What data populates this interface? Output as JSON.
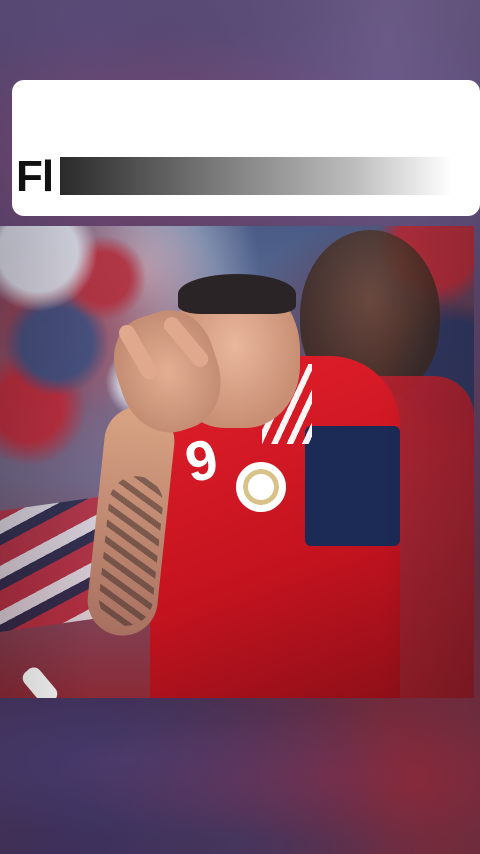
{
  "caption": {
    "text": "Fl"
  },
  "video": {
    "jersey_number": "9"
  },
  "colors": {
    "jersey_red": "#e21f2b",
    "jersey_navy": "#1c2a56",
    "caption_background": "#ffffff",
    "caption_text": "#111111"
  }
}
